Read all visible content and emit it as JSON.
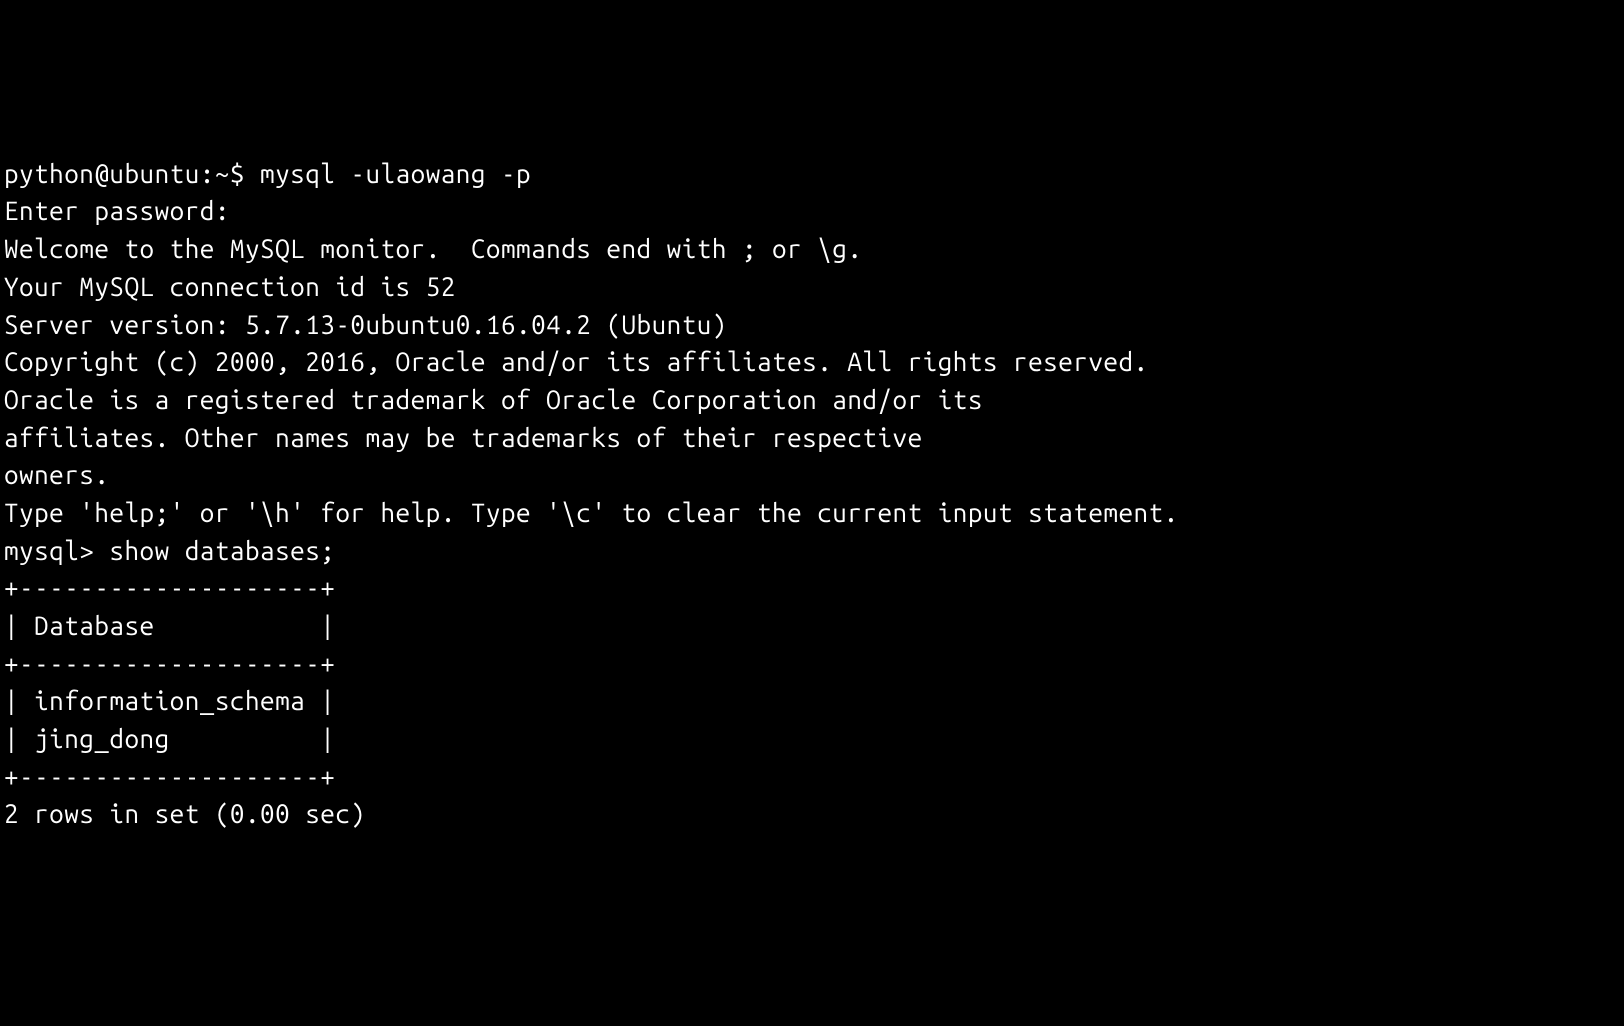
{
  "terminal": {
    "shell_prompt": "python@ubuntu:~$ ",
    "shell_command": "mysql -ulaowang -p",
    "password_prompt": "Enter password:",
    "welcome_line1": "Welcome to the MySQL monitor.  Commands end with ; or \\g.",
    "welcome_line2": "Your MySQL connection id is 52",
    "welcome_line3": "Server version: 5.7.13-0ubuntu0.16.04.2 (Ubuntu)",
    "blank1": "",
    "copyright": "Copyright (c) 2000, 2016, Oracle and/or its affiliates. All rights reserved.",
    "blank2": "",
    "trademark_line1": "Oracle is a registered trademark of Oracle Corporation and/or its",
    "trademark_line2": "affiliates. Other names may be trademarks of their respective",
    "trademark_line3": "owners.",
    "blank3": "",
    "help_line": "Type 'help;' or '\\h' for help. Type '\\c' to clear the current input statement.",
    "blank4": "",
    "mysql_prompt": "mysql> ",
    "mysql_command": "show databases;",
    "table_border_top": "+--------------------+",
    "table_header": "| Database           |",
    "table_border_mid": "+--------------------+",
    "table_row1": "| information_schema |",
    "table_row2": "| jing_dong          |",
    "table_border_bot": "+--------------------+",
    "result_summary": "2 rows in set (0.00 sec)"
  }
}
